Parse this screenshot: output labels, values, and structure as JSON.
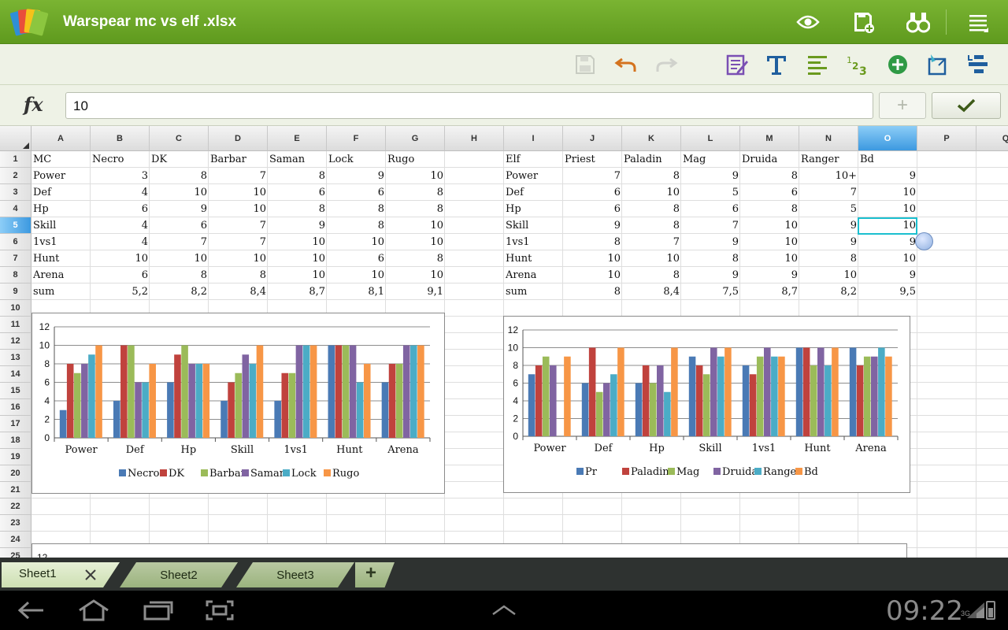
{
  "app": {
    "title": "Warspear mc vs elf .xlsx"
  },
  "formula_bar": {
    "fx_label": "fx",
    "value": "10",
    "add_label": "+",
    "confirm_icon": "check-icon"
  },
  "grid": {
    "columns": [
      "A",
      "B",
      "C",
      "D",
      "E",
      "F",
      "G",
      "H",
      "I",
      "J",
      "K",
      "L",
      "M",
      "N",
      "O",
      "P",
      "Q"
    ],
    "selected_column": "O",
    "rows": [
      "1",
      "2",
      "3",
      "4",
      "5",
      "6",
      "7",
      "8",
      "9",
      "10",
      "11",
      "12",
      "13",
      "14",
      "15",
      "16",
      "17",
      "18",
      "19",
      "20",
      "21",
      "22",
      "23",
      "24",
      "25"
    ],
    "selected_row": "5",
    "selected_cell": "O5",
    "mc_table": [
      [
        "MC",
        "Necro",
        "DK",
        "Barbar",
        "Saman",
        "Lock",
        "Rugo"
      ],
      [
        "Power",
        "3",
        "8",
        "7",
        "8",
        "9",
        "10"
      ],
      [
        "Def",
        "4",
        "10",
        "10",
        "6",
        "6",
        "8"
      ],
      [
        "Hp",
        "6",
        "9",
        "10",
        "8",
        "8",
        "8"
      ],
      [
        "Skill",
        "4",
        "6",
        "7",
        "9",
        "8",
        "10"
      ],
      [
        "1vs1",
        "4",
        "7",
        "7",
        "10",
        "10",
        "10"
      ],
      [
        "Hunt",
        "10",
        "10",
        "10",
        "10",
        "6",
        "8"
      ],
      [
        "Arena",
        "6",
        "8",
        "8",
        "10",
        "10",
        "10"
      ],
      [
        "sum",
        "5,2",
        "8,2",
        "8,4",
        "8,7",
        "8,1",
        "9,1"
      ]
    ],
    "elf_table": [
      [
        "Elf",
        "Priest",
        "Paladin",
        "Mag",
        "Druida",
        "Ranger",
        "Bd"
      ],
      [
        "Power",
        "7",
        "8",
        "9",
        "8",
        "10+",
        "9"
      ],
      [
        "Def",
        "6",
        "10",
        "5",
        "6",
        "7",
        "10"
      ],
      [
        "Hp",
        "6",
        "8",
        "6",
        "8",
        "5",
        "10"
      ],
      [
        "Skill",
        "9",
        "8",
        "7",
        "10",
        "9",
        "10"
      ],
      [
        "1vs1",
        "8",
        "7",
        "9",
        "10",
        "9",
        "9"
      ],
      [
        "Hunt",
        "10",
        "10",
        "8",
        "10",
        "8",
        "10"
      ],
      [
        "Arena",
        "10",
        "8",
        "9",
        "9",
        "10",
        "9"
      ],
      [
        "sum",
        "8",
        "8,4",
        "7,5",
        "8,7",
        "8,2",
        "9,5"
      ]
    ]
  },
  "chart_data": [
    {
      "type": "bar",
      "categories": [
        "Power",
        "Def",
        "Hp",
        "Skill",
        "1vs1",
        "Hunt",
        "Arena"
      ],
      "ylim": [
        0,
        12
      ],
      "yticks": [
        "0",
        "2",
        "4",
        "6",
        "8",
        "10",
        "12"
      ],
      "grid": true,
      "legend_position": "bottom",
      "series": [
        {
          "name": "Necro",
          "color": "#4a7ab5",
          "values": [
            3,
            4,
            6,
            4,
            4,
            10,
            6
          ]
        },
        {
          "name": "DK",
          "color": "#c0423d",
          "values": [
            8,
            10,
            9,
            6,
            7,
            10,
            8
          ]
        },
        {
          "name": "Barbar",
          "color": "#9bbb59",
          "values": [
            7,
            10,
            10,
            7,
            7,
            10,
            8
          ]
        },
        {
          "name": "Saman",
          "color": "#8064a2",
          "values": [
            8,
            6,
            8,
            9,
            10,
            10,
            10
          ]
        },
        {
          "name": "Lock",
          "color": "#4bacc6",
          "values": [
            9,
            6,
            8,
            8,
            10,
            6,
            10
          ]
        },
        {
          "name": "Rugo",
          "color": "#f79646",
          "values": [
            10,
            8,
            8,
            10,
            10,
            8,
            10
          ]
        }
      ]
    },
    {
      "type": "bar",
      "categories": [
        "Power",
        "Def",
        "Hp",
        "Skill",
        "1vs1",
        "Hunt",
        "Arena"
      ],
      "ylim": [
        0,
        12
      ],
      "yticks": [
        "0",
        "2",
        "4",
        "6",
        "8",
        "10",
        "12"
      ],
      "grid": true,
      "legend_position": "bottom",
      "series": [
        {
          "name": "Pr",
          "color": "#4a7ab5",
          "values": [
            7,
            6,
            6,
            9,
            8,
            10,
            10
          ]
        },
        {
          "name": "Paladin",
          "color": "#c0423d",
          "values": [
            8,
            10,
            8,
            8,
            7,
            10,
            8
          ]
        },
        {
          "name": "Mag",
          "color": "#9bbb59",
          "values": [
            9,
            5,
            6,
            7,
            9,
            8,
            9
          ]
        },
        {
          "name": "Druida",
          "color": "#8064a2",
          "values": [
            8,
            6,
            8,
            10,
            10,
            10,
            9
          ]
        },
        {
          "name": "Ranger",
          "color": "#4bacc6",
          "values": [
            0,
            7,
            5,
            9,
            9,
            8,
            10
          ]
        },
        {
          "name": "Bd",
          "color": "#f79646",
          "values": [
            9,
            10,
            10,
            10,
            9,
            10,
            9
          ]
        }
      ]
    }
  ],
  "third_chart_partial": {
    "visible_tick": "12"
  },
  "sheet_tabs": {
    "tabs": [
      {
        "label": "Sheet1",
        "active": true
      },
      {
        "label": "Sheet2",
        "active": false
      },
      {
        "label": "Sheet3",
        "active": false
      }
    ],
    "add_label": "+",
    "close_icon": "close-icon"
  },
  "navbar": {
    "clock": "09:22",
    "network": "3G"
  },
  "icons": {
    "titlebar": [
      "eye-icon",
      "save-as-icon",
      "find-icon",
      "menu-icon"
    ],
    "toolbar": [
      "save-icon",
      "undo-icon",
      "redo-icon",
      "edit-icon",
      "text-format-icon",
      "align-icon",
      "number-format-icon",
      "insert-icon",
      "cell-format-icon",
      "row-col-icon"
    ]
  },
  "colors": {
    "brand_green": "#6aa628",
    "selection": "#1bbfcf",
    "header_selected": "#3c99e0"
  }
}
